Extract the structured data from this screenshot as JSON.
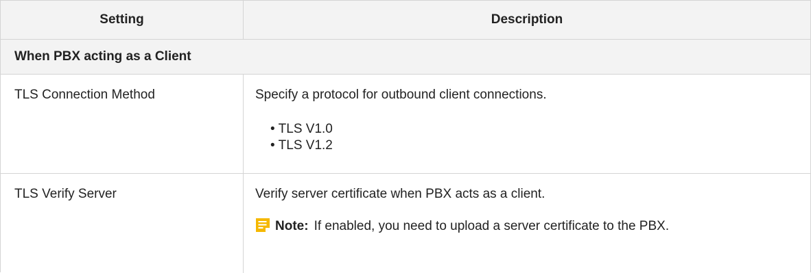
{
  "table": {
    "headers": {
      "setting": "Setting",
      "description": "Description"
    },
    "section_title": "When PBX acting as a Client",
    "rows": [
      {
        "setting": "TLS Connection Method",
        "description": "Specify a protocol for outbound client connections.",
        "options": [
          "TLS V1.0",
          "TLS V1.2"
        ]
      },
      {
        "setting": "TLS Verify Server",
        "description": "Verify server certificate when PBX acts as a client.",
        "note_label": "Note:",
        "note_text": "If enabled, you need to upload a server certificate to the PBX."
      }
    ]
  },
  "colors": {
    "header_bg": "#f3f3f3",
    "border": "#d4d4d4",
    "note_icon": "#f5b800"
  },
  "icons": {
    "note": "note-icon"
  }
}
